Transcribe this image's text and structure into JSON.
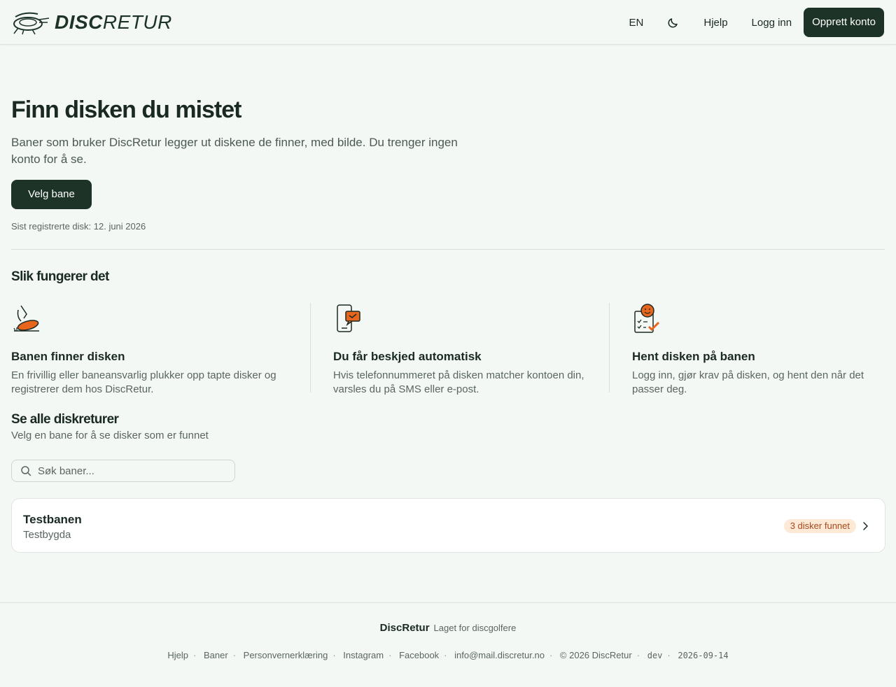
{
  "header": {
    "logo_bold": "DISC",
    "logo_light": "RETUR",
    "lang": "EN",
    "help": "Hjelp",
    "login": "Logg inn",
    "signup": "Opprett konto"
  },
  "hero": {
    "title": "Finn disken du mistet",
    "text": "Baner som bruker DiscRetur legger ut diskene de finner, med bilde. Du trenger ingen konto for å se.",
    "cta": "Velg bane",
    "last_registered": "Sist registrerte disk: 12. juni 2026"
  },
  "how": {
    "title": "Slik fungerer det",
    "steps": [
      {
        "icon": "disc-pickup-icon",
        "title": "Banen finner disken",
        "text": "En frivillig eller baneansvarlig plukker opp tapte disker og registrerer dem hos DiscRetur."
      },
      {
        "icon": "phone-notification-icon",
        "title": "Du får beskjed automatisk",
        "text": "Hvis telefonnummeret på disken matcher kontoen din, varsles du på SMS eller e-post."
      },
      {
        "icon": "checklist-smile-icon",
        "title": "Hent disken på banen",
        "text": "Logg inn, gjør krav på disken, og hent den når det passer deg."
      }
    ]
  },
  "all": {
    "title": "Se alle diskreturer",
    "subtitle": "Velg en bane for å se disker som er funnet",
    "search_placeholder": "Søk baner...",
    "courses": [
      {
        "name": "Testbanen",
        "location": "Testbygda",
        "badge": "3 disker funnet"
      }
    ]
  },
  "footer": {
    "brand": "DiscRetur",
    "tagline": "Laget for discgolfere",
    "links": [
      "Hjelp",
      "Baner",
      "Personvernerklæring",
      "Instagram",
      "Facebook",
      "info@mail.discretur.no",
      "© 2026 DiscRetur",
      "dev",
      "2026-09-14"
    ]
  },
  "colors": {
    "primary": "#1d3327",
    "background": "#f4f8f5",
    "accent": "#e8651d",
    "badge_bg": "#fde9d6",
    "badge_text": "#a8491b"
  }
}
